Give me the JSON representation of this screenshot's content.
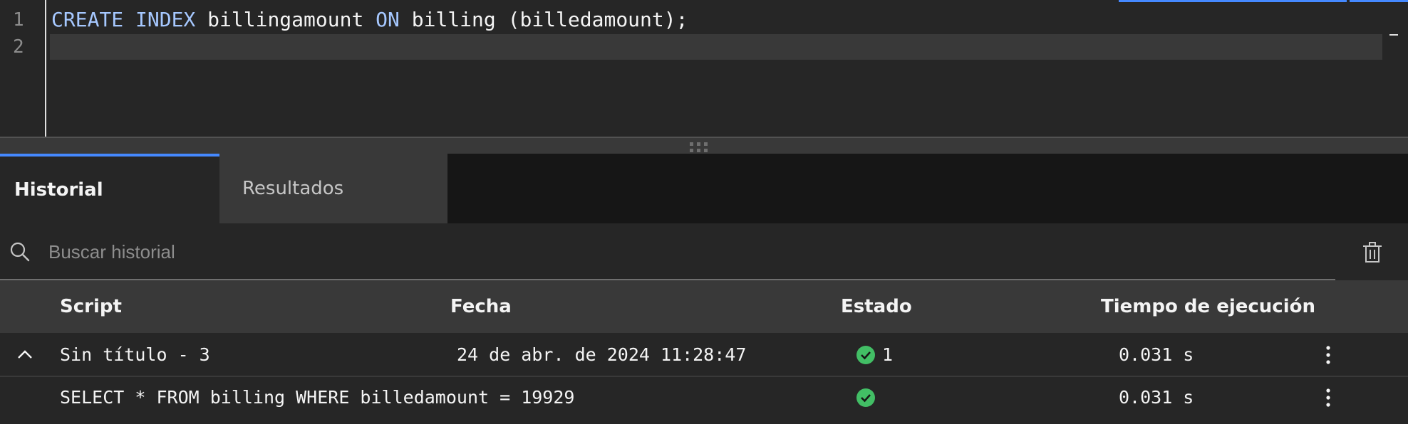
{
  "editor": {
    "lines": [
      {
        "number": "1",
        "tokens": [
          {
            "text": "CREATE INDEX",
            "kind": "keyword"
          },
          {
            "text": " billingamount ",
            "kind": "plain"
          },
          {
            "text": "ON",
            "kind": "keyword"
          },
          {
            "text": " billing (billedamount);",
            "kind": "plain"
          }
        ]
      },
      {
        "number": "2",
        "tokens": []
      }
    ]
  },
  "tabs": {
    "history": "Historial",
    "results": "Resultados"
  },
  "search": {
    "placeholder": "Buscar historial"
  },
  "table": {
    "headers": {
      "script": "Script",
      "date": "Fecha",
      "status": "Estado",
      "exec_time": "Tiempo de ejecución"
    },
    "rows": [
      {
        "script": "Sin título - 3",
        "date": "24 de abr. de 2024 11:28:47",
        "status_count": "1",
        "exec_time": "0.031 s",
        "expanded": true
      },
      {
        "script": "SELECT * FROM billing WHERE billedamount = 19929",
        "date": "",
        "status_count": "",
        "exec_time": "0.031 s",
        "expanded": false
      }
    ]
  },
  "colors": {
    "accent": "#4589ff",
    "success": "#42be65",
    "keyword": "#a6c8ff"
  }
}
